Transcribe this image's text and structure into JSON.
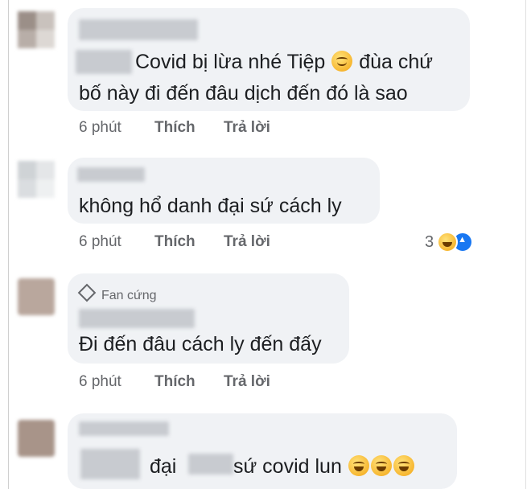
{
  "comments": [
    {
      "lines": [
        "Covid bị lừa nhé Tiệp",
        "đùa chứ",
        "bố này đi đến đâu dịch đến đó là sao"
      ],
      "emoji": "tear-smile-emoji",
      "time": "6 phút",
      "like_label": "Thích",
      "reply_label": "Trả lời"
    },
    {
      "lines": [
        "không hổ danh đại sứ cách ly"
      ],
      "time": "6 phút",
      "like_label": "Thích",
      "reply_label": "Trả lời",
      "reaction_count": "3",
      "reaction_icons": [
        "haha-icon",
        "like-icon"
      ]
    },
    {
      "badge": "Fan cứng",
      "lines": [
        "Đi đến đâu cách ly đến đấy"
      ],
      "time": "6 phút",
      "like_label": "Thích",
      "reply_label": "Trả lời"
    },
    {
      "segments": [
        "đại",
        "sứ covid lun"
      ],
      "emoji": "rofl-emoji"
    }
  ],
  "colors": {
    "bubble": "#f0f2f5",
    "meta_text": "#65676b",
    "text": "#1c1e21",
    "like_blue": "#1877f2"
  }
}
